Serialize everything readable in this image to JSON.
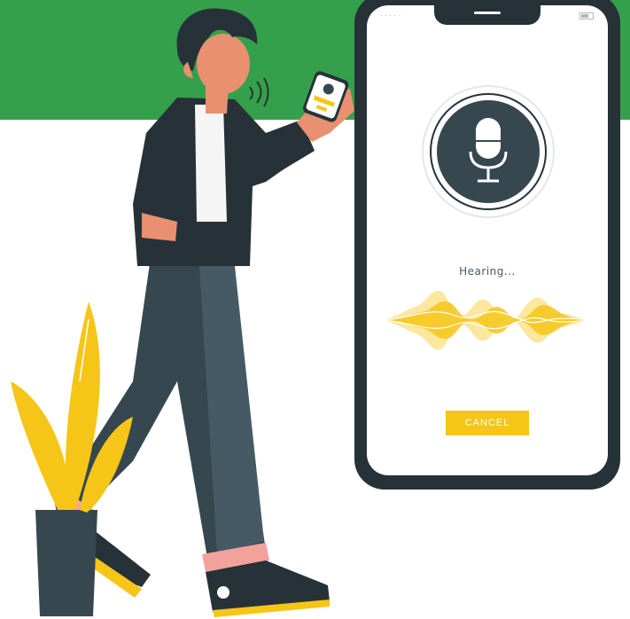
{
  "colors": {
    "brand_green": "#34a04c",
    "accent_yellow": "#f5c518",
    "dark": "#263238"
  },
  "phone": {
    "status_icon_dots": ".....",
    "mic_icon": "microphone-icon",
    "status_text": "Hearing...",
    "cancel_label": "CANCEL"
  }
}
